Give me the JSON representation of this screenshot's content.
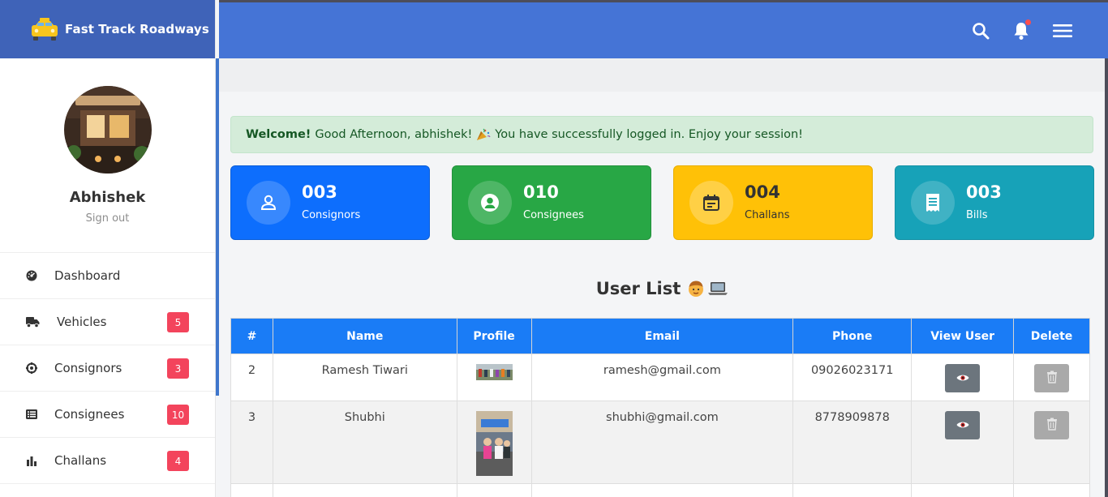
{
  "brand": {
    "name": "Fast Track Roadways",
    "icon": "taxi-icon"
  },
  "profile": {
    "name": "Abhishek",
    "signout": "Sign out"
  },
  "sidebar": {
    "items": [
      {
        "label": "Dashboard",
        "icon": "dashboard-icon",
        "badge": null
      },
      {
        "label": "Vehicles",
        "icon": "truck-icon",
        "badge": "5"
      },
      {
        "label": "Consignors",
        "icon": "target-icon",
        "badge": "3"
      },
      {
        "label": "Consignees",
        "icon": "list-icon",
        "badge": "10"
      },
      {
        "label": "Challans",
        "icon": "bar-chart-icon",
        "badge": "4"
      }
    ]
  },
  "topbar": {
    "icons": [
      "search-icon",
      "bell-icon",
      "menu-icon"
    ]
  },
  "alert": {
    "strong": "Welcome!",
    "text": "Good Afternoon, abhishek!",
    "text2": "You have successfully logged in. Enjoy your session!"
  },
  "cards": [
    {
      "value": "003",
      "label": "Consignors",
      "color": "#0d6efd",
      "icon": "user-icon"
    },
    {
      "value": "010",
      "label": "Consignees",
      "color": "#28a745",
      "icon": "user-circle-icon"
    },
    {
      "value": "004",
      "label": "Challans",
      "color": "#ffc107",
      "icon": "calendar-icon"
    },
    {
      "value": "003",
      "label": "Bills",
      "color": "#17a2b8",
      "icon": "receipt-icon"
    }
  ],
  "user_list": {
    "title": "User List",
    "headers": [
      "#",
      "Name",
      "Profile",
      "Email",
      "Phone",
      "View User",
      "Delete"
    ],
    "rows": [
      {
        "id": "2",
        "name": "Ramesh Tiwari",
        "email": "ramesh@gmail.com",
        "phone": "09026023171"
      },
      {
        "id": "3",
        "name": "Shubhi",
        "email": "shubhi@gmail.com",
        "phone": "8778909878"
      }
    ]
  },
  "colors": {
    "header_blue": "#4574d6",
    "brand_blue": "#3f63b8",
    "table_header": "#1a7cf6",
    "badge_red": "#f3445c",
    "alert_green": "#d4ecd9"
  }
}
